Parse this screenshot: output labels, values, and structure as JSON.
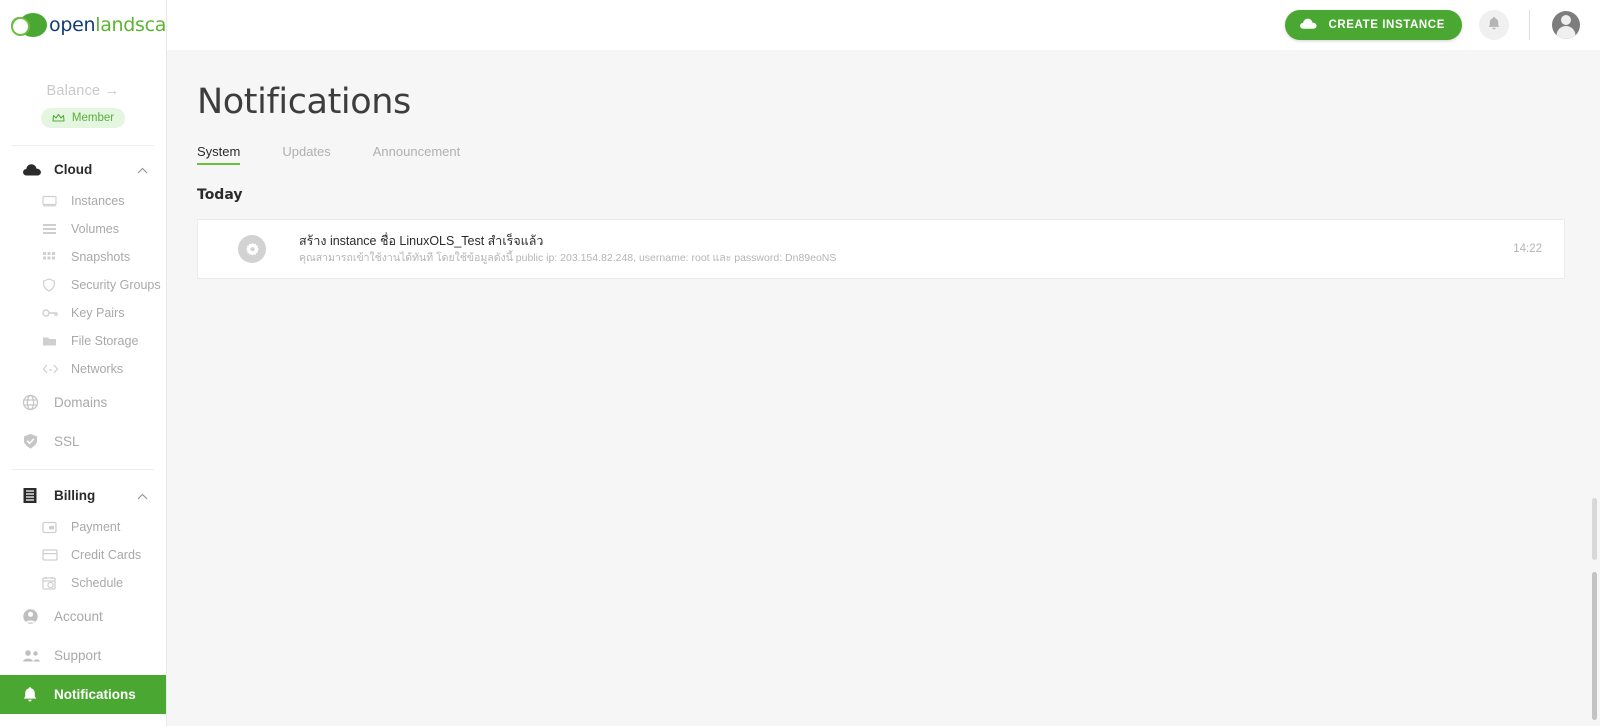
{
  "brand": {
    "logo_open": "open",
    "logo_land": "land",
    "logo_scape": "scape",
    "accent_green": "#4aa832",
    "logo_blue": "#0f3b7a"
  },
  "sidebar": {
    "balance_label": "Balance",
    "balance_arrow": "→",
    "member_badge": "Member",
    "groups": [
      {
        "label": "Cloud",
        "icon": "cloud-icon",
        "expanded": true,
        "items": [
          {
            "label": "Instances",
            "icon": "monitor-icon"
          },
          {
            "label": "Volumes",
            "icon": "volumes-icon"
          },
          {
            "label": "Snapshots",
            "icon": "snapshots-icon"
          },
          {
            "label": "Security Groups",
            "icon": "shield-icon"
          },
          {
            "label": "Key Pairs",
            "icon": "key-icon"
          },
          {
            "label": "File Storage",
            "icon": "folder-icon"
          },
          {
            "label": "Networks",
            "icon": "code-brackets-icon"
          }
        ]
      }
    ],
    "standalone": [
      {
        "label": "Domains",
        "icon": "globe-icon"
      },
      {
        "label": "SSL",
        "icon": "shield-check-icon"
      }
    ],
    "billing": {
      "label": "Billing",
      "icon": "billing-icon",
      "expanded": true,
      "items": [
        {
          "label": "Payment",
          "icon": "wallet-icon"
        },
        {
          "label": "Credit Cards",
          "icon": "credit-card-icon"
        },
        {
          "label": "Schedule",
          "icon": "schedule-icon"
        }
      ]
    },
    "bottom": [
      {
        "label": "Account",
        "icon": "account-icon",
        "active": false
      },
      {
        "label": "Support",
        "icon": "support-icon",
        "active": false
      },
      {
        "label": "Notifications",
        "icon": "bell-icon",
        "active": true
      }
    ]
  },
  "topbar": {
    "create_instance_label": "CREATE INSTANCE",
    "create_instance_icon": "cloud-icon",
    "bell_icon": "bell-icon",
    "avatar_icon": "avatar"
  },
  "page": {
    "title": "Notifications",
    "tabs": [
      {
        "label": "System",
        "active": true
      },
      {
        "label": "Updates",
        "active": false
      },
      {
        "label": "Announcement",
        "active": false
      }
    ],
    "day_label": "Today"
  },
  "notifications": [
    {
      "icon": "gear-icon",
      "title": "สร้าง instance ชื่อ LinuxOLS_Test สำเร็จแล้ว",
      "subtitle": "คุณสามารถเข้าใช้งานได้ทันที โดยใช้ข้อมูลดังนี้ public ip: 203.154.82.248, username: root และ password: Dn89eoNS",
      "time": "14:22"
    }
  ]
}
